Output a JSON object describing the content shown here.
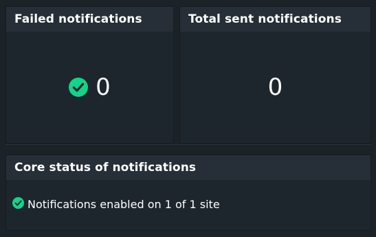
{
  "failed_panel": {
    "title": "Failed notifications",
    "value": "0",
    "status_icon": "check-circle-icon",
    "status_color": "#13d389"
  },
  "total_panel": {
    "title": "Total sent notifications",
    "value": "0"
  },
  "core_panel": {
    "title": "Core status of notifications",
    "status_icon": "check-circle-icon",
    "status_text": "Notifications enabled on 1 of 1 site"
  },
  "colors": {
    "background": "#1b2228",
    "panel": "#1e262d",
    "header": "#262f37",
    "ok": "#13d389",
    "text": "#ffffff"
  }
}
